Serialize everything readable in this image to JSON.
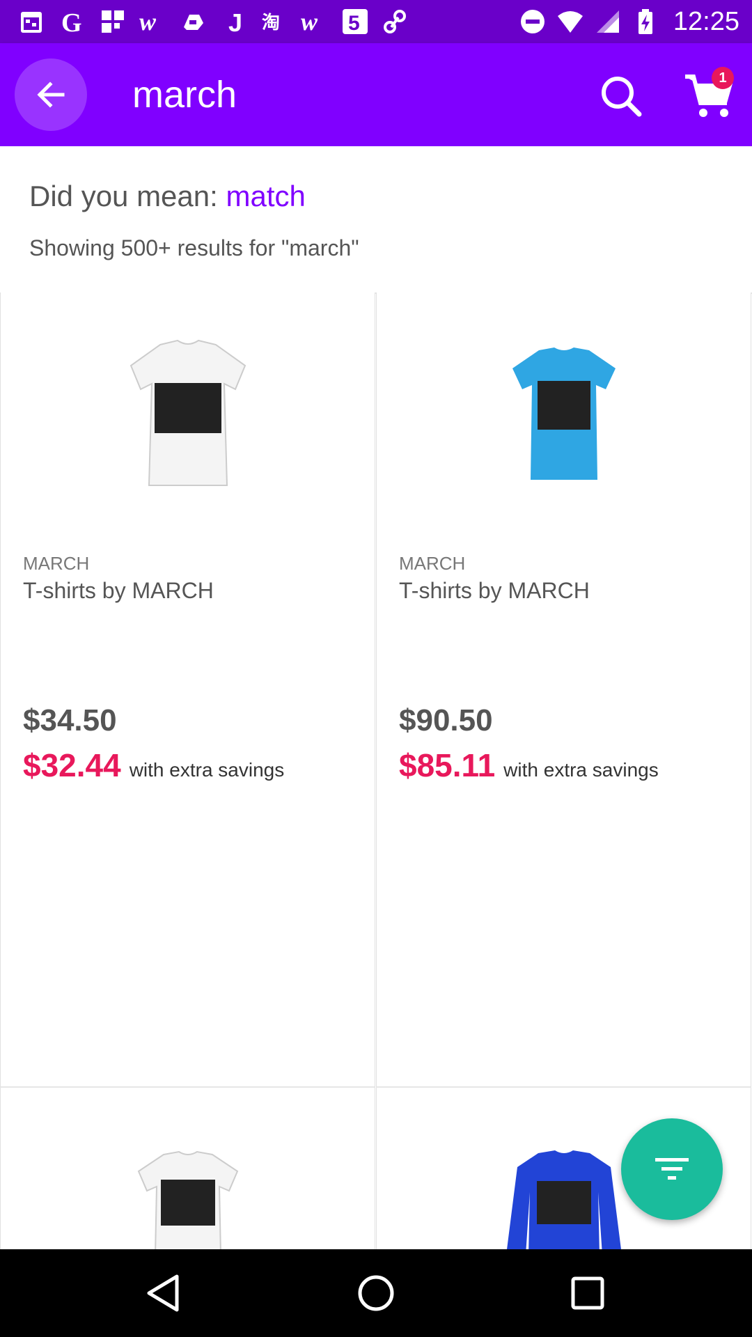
{
  "status_bar": {
    "time": "12:25",
    "notification_icons": [
      "calendar-icon",
      "google-icon",
      "grid-app-icon",
      "w-app-icon",
      "cloud-app-icon",
      "j-app-icon",
      "taobao-icon",
      "w2-app-icon",
      "number-5-app-icon",
      "link-app-icon"
    ],
    "system_icons": [
      "do-not-disturb-icon",
      "wifi-icon",
      "signal-icon",
      "battery-charging-icon"
    ]
  },
  "app_bar": {
    "query": "march",
    "cart_count": "1",
    "colors": {
      "bar": "#8000ff",
      "status": "#6a00c9"
    }
  },
  "suggestion": {
    "prefix": "Did you mean: ",
    "suggested": "match",
    "summary": "Showing 500+ results for \"march\""
  },
  "products": [
    {
      "brand": "MARCH",
      "name": "T-shirts by MARCH",
      "price": "$34.50",
      "sale_price": "$32.44",
      "sale_note": "with extra savings",
      "image": "white-tshirt-black-square"
    },
    {
      "brand": "MARCH",
      "name": "T-shirts by MARCH",
      "price": "$90.50",
      "sale_price": "$85.11",
      "sale_note": "with extra savings",
      "image": "blue-tshirt-black-square"
    },
    {
      "image": "white-tshirt-black-square-partial"
    },
    {
      "image": "blue-sweater-black-square-partial"
    }
  ],
  "fab": {
    "icon": "filter-icon",
    "color": "#1abc9c"
  },
  "accent_colors": {
    "sale": "#e8185b",
    "link": "#8000ff"
  }
}
